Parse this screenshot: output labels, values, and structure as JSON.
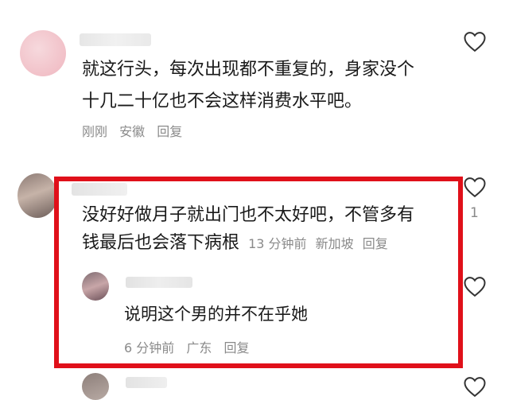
{
  "comments": [
    {
      "text_lines": [
        "就这行头，每次出现都不重复的，身家没个",
        "十几二十亿也不会这样消费水平吧。"
      ],
      "time": "刚刚",
      "location": "安徽",
      "reply": "回复"
    },
    {
      "text_line_1": "没好好做月子就出门也不太好吧，不管多有",
      "text_line_2": "钱最后也会落下病根",
      "time": "13 分钟前",
      "location": "新加坡",
      "reply": "回复",
      "like_count": "1"
    }
  ],
  "reply_comment": {
    "text": "说明这个男的并不在乎她",
    "time": "6 分钟前",
    "location": "广东",
    "reply": "回复"
  },
  "colors": {
    "highlight": "#e0101a",
    "meta": "#8a8a8a"
  }
}
